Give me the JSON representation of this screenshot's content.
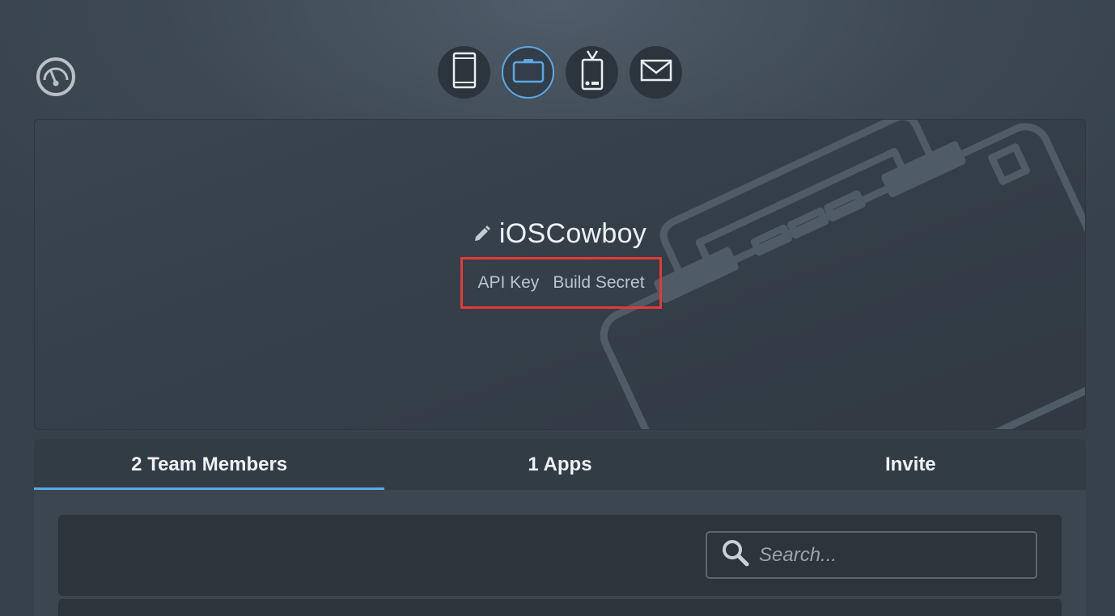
{
  "top_nav": {
    "items": [
      {
        "icon": "phone-icon",
        "active": false
      },
      {
        "icon": "briefcase-icon",
        "active": true
      },
      {
        "icon": "badge-icon",
        "active": false
      },
      {
        "icon": "envelope-icon",
        "active": false
      }
    ]
  },
  "profile": {
    "org_name": "iOSCowboy",
    "links": {
      "api_key": "API Key",
      "build_secret": "Build Secret"
    }
  },
  "tabs": [
    {
      "label": "2 Team Members",
      "active": true
    },
    {
      "label": "1 Apps",
      "active": false
    },
    {
      "label": "Invite",
      "active": false
    }
  ],
  "search": {
    "placeholder": "Search...",
    "value": ""
  },
  "colors": {
    "accent": "#5aa9e6",
    "highlight": "#e53935"
  }
}
